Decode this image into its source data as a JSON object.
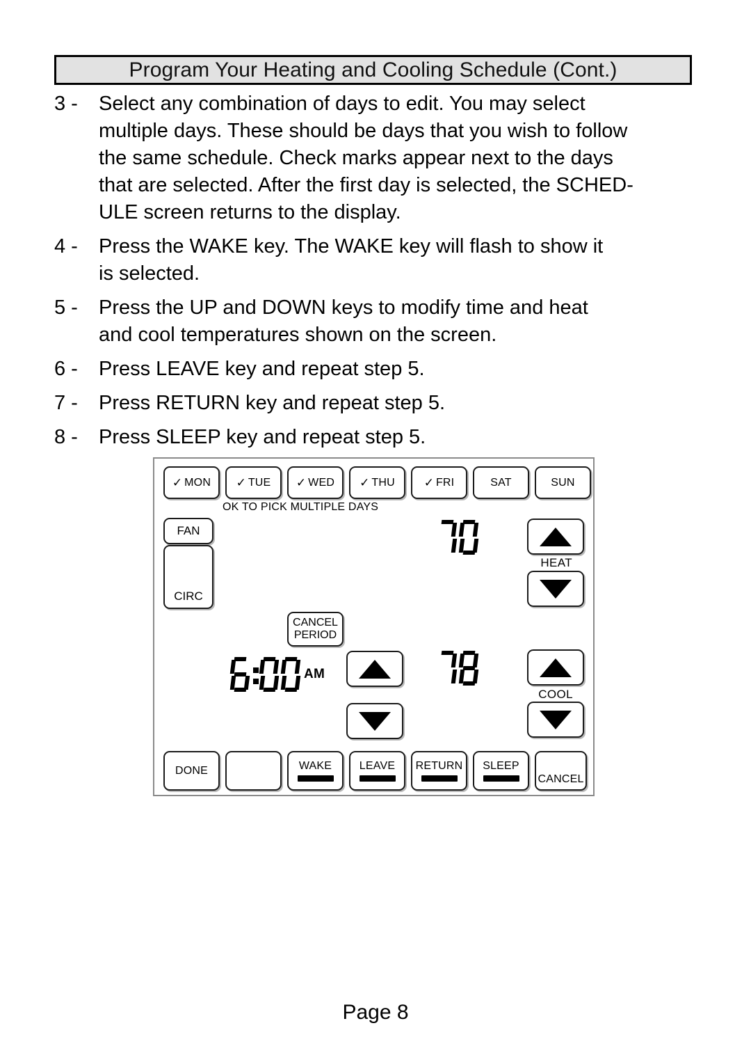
{
  "document": {
    "title": "Program Your Heating and Cooling Schedule (Cont.)",
    "page_label": "Page 8"
  },
  "instructions": [
    {
      "number": "3 -",
      "lines": [
        "Select any combination of days to edit. You may select",
        "multiple days. These should be days that you wish to follow",
        "the same schedule. Check marks appear next to the days",
        "that are selected. After the first day is selected, the SCHED-",
        "ULE screen returns to the display."
      ]
    },
    {
      "number": "4 -",
      "lines": [
        "Press the WAKE key. The WAKE key will flash to show it",
        "is selected."
      ]
    },
    {
      "number": "5 -",
      "lines": [
        "Press the UP and DOWN keys to modify time and heat",
        "and cool temperatures shown on the screen."
      ]
    },
    {
      "number": "6 -",
      "lines": [
        "Press LEAVE key and repeat step 5."
      ]
    },
    {
      "number": "7 -",
      "lines": [
        "Press RETURN key and repeat step 5."
      ]
    },
    {
      "number": "8 -",
      "lines": [
        "Press SLEEP key and repeat step 5."
      ]
    }
  ],
  "thermostat": {
    "days": [
      {
        "label": "MON",
        "checked": true,
        "check_mark": "✓"
      },
      {
        "label": "TUE",
        "checked": true,
        "check_mark": "✓"
      },
      {
        "label": "WED",
        "checked": true,
        "check_mark": "✓"
      },
      {
        "label": "THU",
        "checked": true,
        "check_mark": "✓"
      },
      {
        "label": "FRI",
        "checked": true,
        "check_mark": "✓"
      },
      {
        "label": "SAT",
        "checked": false,
        "check_mark": ""
      },
      {
        "label": "SUN",
        "checked": false,
        "check_mark": ""
      }
    ],
    "hint": "OK TO PICK MULTIPLE DAYS",
    "fan_label": "FAN",
    "circ_label": "CIRC",
    "cancel_period": {
      "line1": "CANCEL",
      "line2": "PERIOD"
    },
    "heat": {
      "label": "HEAT",
      "value": "70",
      "up_icon": "triangle-up-icon",
      "down_icon": "triangle-down-icon"
    },
    "cool": {
      "label": "COOL",
      "value": "78",
      "up_icon": "triangle-up-icon",
      "down_icon": "triangle-down-icon"
    },
    "time": {
      "value": "6:00",
      "meridiem": "AM",
      "up_icon": "triangle-up-icon",
      "down_icon": "triangle-down-icon"
    },
    "bottom_keys": [
      {
        "label": "DONE",
        "bar": false
      },
      {
        "label": "",
        "bar": false
      },
      {
        "label": "WAKE",
        "bar": true
      },
      {
        "label": "LEAVE",
        "bar": true
      },
      {
        "label": "RETURN",
        "bar": true
      },
      {
        "label": "SLEEP",
        "bar": true
      },
      {
        "label": "CANCEL",
        "bar": false
      }
    ]
  },
  "colors": {
    "title_background": "#e2e2e2",
    "border": "#000000",
    "panel_border": "#8a8a8a",
    "key_shadow": "#b9b9b9",
    "text": "#000000"
  }
}
